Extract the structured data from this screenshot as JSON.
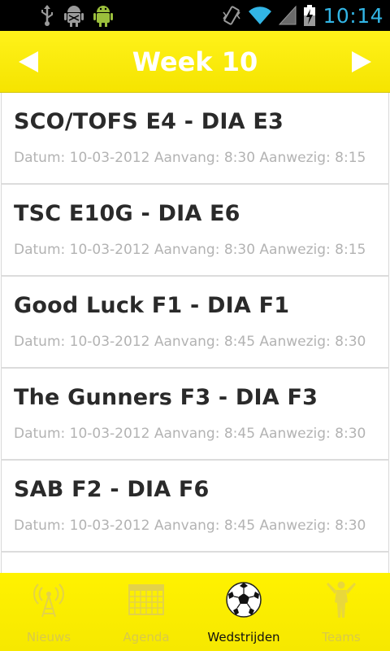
{
  "status_bar": {
    "time": "10:14",
    "left_icons": [
      "usb-icon",
      "android-debug-icon",
      "android-icon"
    ],
    "right_icons": [
      "vibrate-icon",
      "wifi-icon",
      "signal-icon",
      "battery-charging-icon"
    ],
    "time_color": "#32b5e5"
  },
  "header": {
    "title": "Week 10",
    "prev_icon": "arrow-left-icon",
    "next_icon": "arrow-right-icon",
    "color": "#f7e900"
  },
  "matches": [
    {
      "teams": "SCO/TOFS E4 - DIA E3",
      "info": "Datum: 10-03-2012 Aanvang: 8:30 Aanwezig: 8:15"
    },
    {
      "teams": "TSC E10G - DIA E6",
      "info": "Datum: 10-03-2012 Aanvang: 8:30 Aanwezig: 8:15"
    },
    {
      "teams": "Good Luck F1 - DIA F1",
      "info": "Datum: 10-03-2012 Aanvang: 8:45 Aanwezig: 8:30"
    },
    {
      "teams": "The Gunners F3 - DIA F3",
      "info": "Datum: 10-03-2012 Aanvang: 8:45 Aanwezig: 8:30"
    },
    {
      "teams": "SAB F2 - DIA F6",
      "info": "Datum: 10-03-2012 Aanvang: 8:45 Aanwezig: 8:30"
    },
    {
      "teams": "",
      "info": ""
    }
  ],
  "tabs": [
    {
      "label": "Nieuws",
      "icon": "antenna-icon",
      "active": false
    },
    {
      "label": "Agenda",
      "icon": "calendar-icon",
      "active": false
    },
    {
      "label": "Wedstrijden",
      "icon": "soccer-ball-icon",
      "active": true
    },
    {
      "label": "Teams",
      "icon": "player-icon",
      "active": false
    }
  ]
}
